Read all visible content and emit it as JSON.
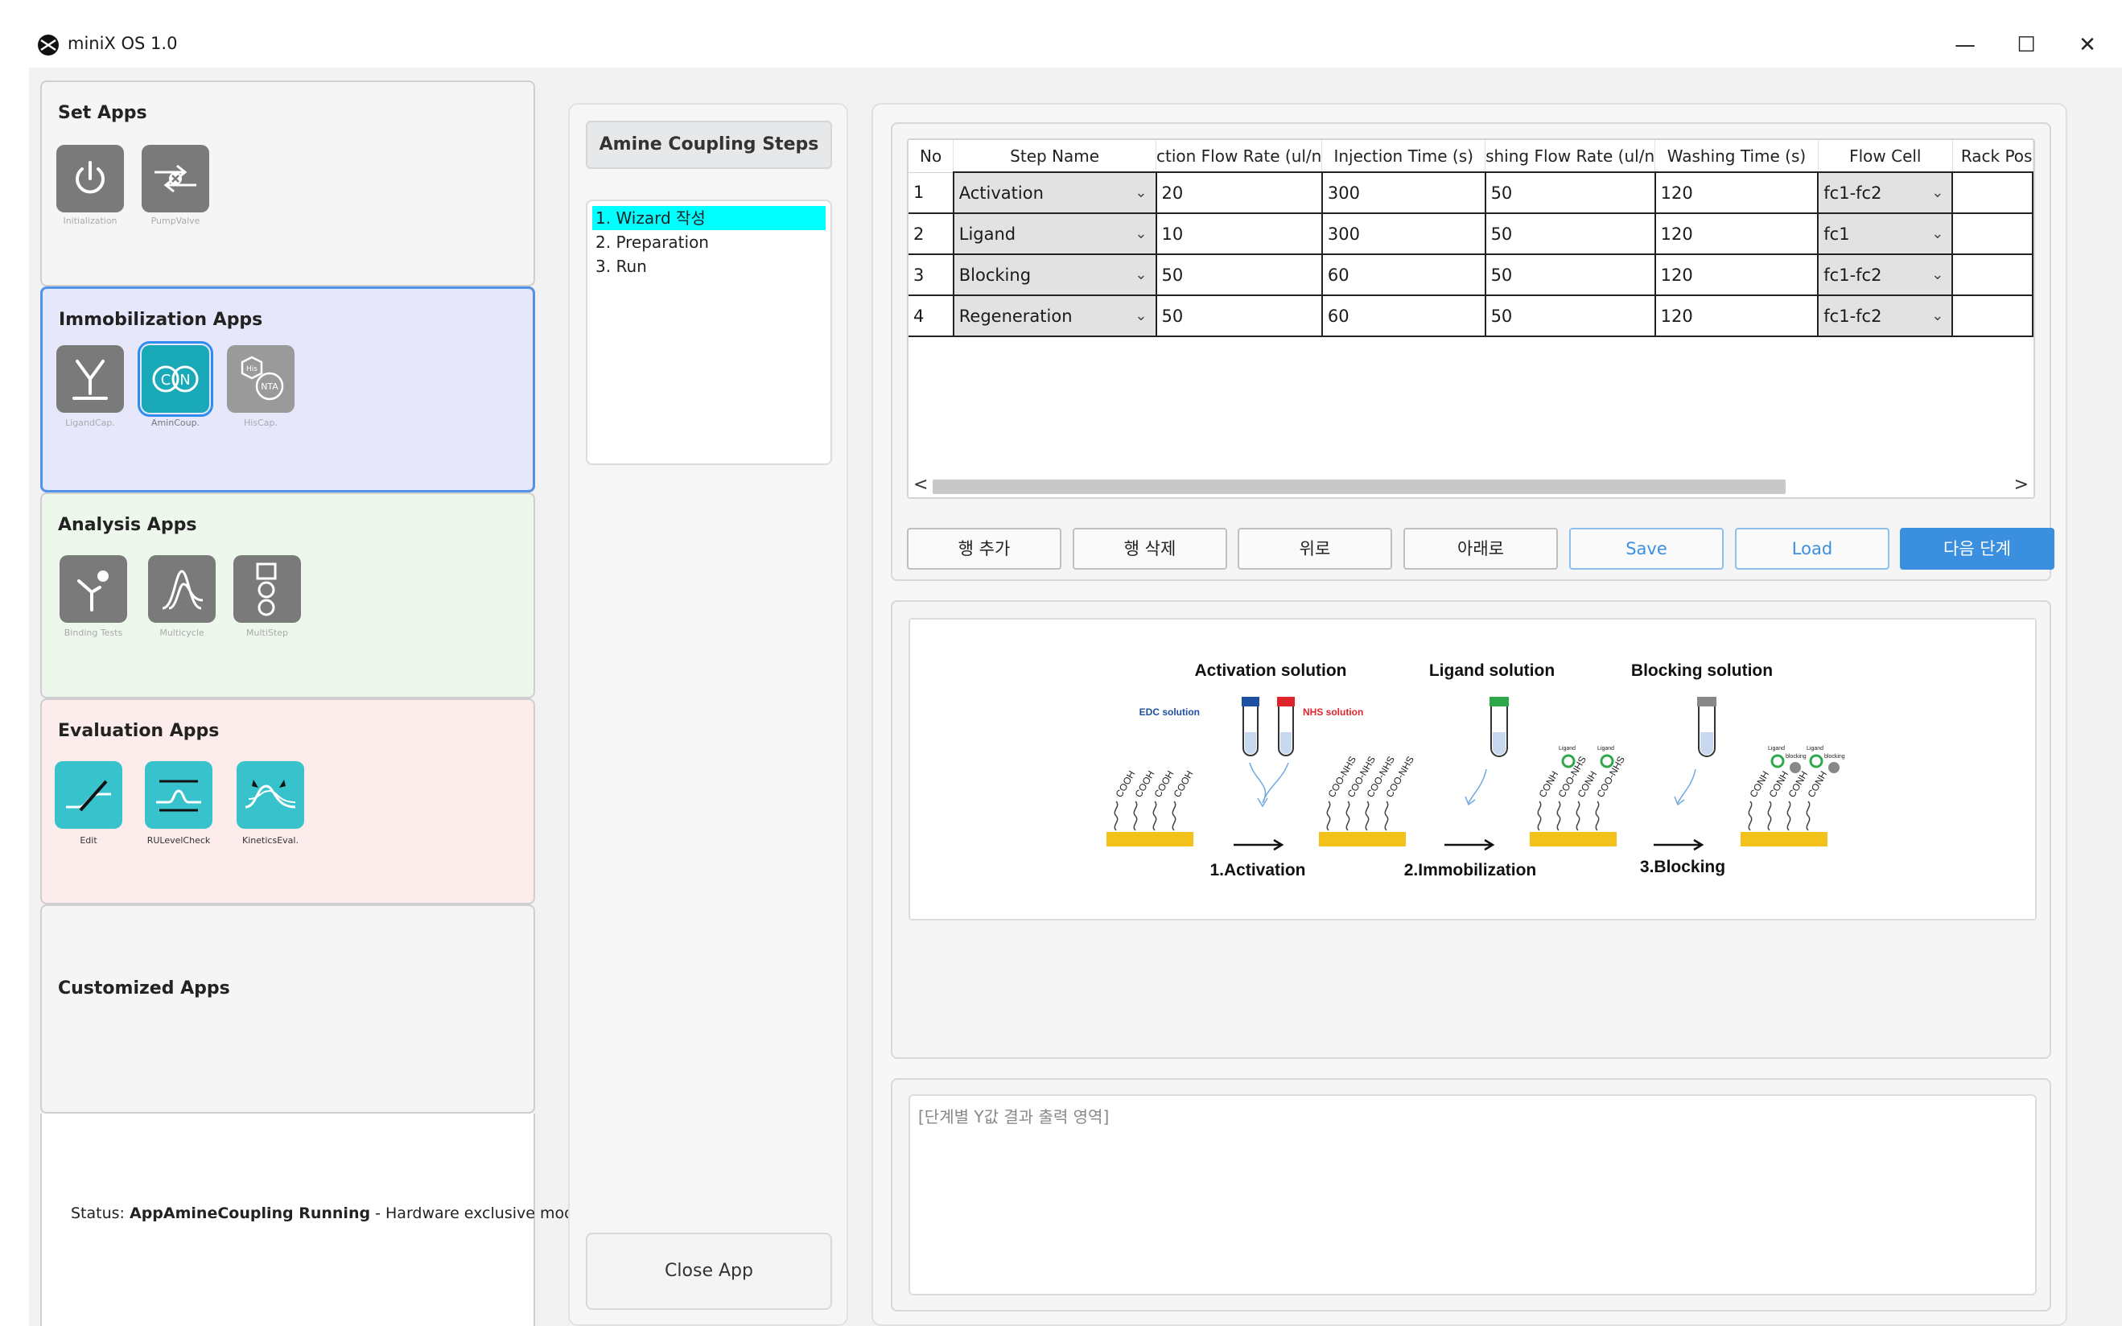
{
  "window": {
    "title": "miniX OS 1.0",
    "minimize": "—",
    "maximize": "☐",
    "close": "✕"
  },
  "groups": {
    "set": {
      "title": "Set Apps",
      "apps": [
        {
          "label": "Initialization"
        },
        {
          "label": "PumpValve"
        }
      ]
    },
    "immobilization": {
      "title": "Immobilization Apps",
      "apps": [
        {
          "label": "LigandCap."
        },
        {
          "label": "AminCoup.",
          "badge": "C N"
        },
        {
          "label": "HisCap.",
          "badge1": "His",
          "badge2": "NTA"
        }
      ]
    },
    "analysis": {
      "title": "Analysis Apps",
      "apps": [
        {
          "label": "Binding Tests"
        },
        {
          "label": "Multicycle"
        },
        {
          "label": "MultiStep"
        }
      ]
    },
    "evaluation": {
      "title": "Evaluation Apps",
      "apps": [
        {
          "label": "Edit"
        },
        {
          "label": "RULevelCheck"
        },
        {
          "label": "KineticsEval."
        }
      ]
    },
    "customized": {
      "title": "Customized Apps"
    }
  },
  "status": {
    "prefix": "Status:",
    "app": "AppAmineCoupling Running",
    "suffix": "- Hardware exclusive mode"
  },
  "steps": {
    "header": "Amine Coupling Steps",
    "items": [
      "1. Wizard 작성",
      "2. Preparation",
      "3. Run"
    ],
    "close_label": "Close App"
  },
  "table": {
    "columns": [
      "No",
      "Step Name",
      "ction Flow Rate (ul/n",
      "Injection Time (s)",
      "shing Flow Rate (ul/n",
      "Washing Time (s)",
      "Flow Cell",
      "Rack Pos"
    ],
    "rows": [
      {
        "no": "1",
        "step": "Activation",
        "flow": "20",
        "inj": "300",
        "wflow": "50",
        "wtime": "120",
        "cell": "fc1-fc2",
        "rack": ""
      },
      {
        "no": "2",
        "step": "Ligand",
        "flow": "10",
        "inj": "300",
        "wflow": "50",
        "wtime": "120",
        "cell": "fc1",
        "rack": ""
      },
      {
        "no": "3",
        "step": "Blocking",
        "flow": "50",
        "inj": "60",
        "wflow": "50",
        "wtime": "120",
        "cell": "fc1-fc2",
        "rack": ""
      },
      {
        "no": "4",
        "step": "Regeneration",
        "flow": "50",
        "inj": "60",
        "wflow": "50",
        "wtime": "120",
        "cell": "fc1-fc2",
        "rack": ""
      }
    ],
    "scroll_left": "<",
    "scroll_right": ">",
    "chevron": "⌄"
  },
  "buttons": {
    "add_row": "행 추가",
    "delete_row": "행 삭제",
    "up": "위로",
    "down": "아래로",
    "save": "Save",
    "load": "Load",
    "next": "다음 단계"
  },
  "diagram": {
    "activation_solution": "Activation solution",
    "ligand_solution": "Ligand solution",
    "blocking_solution": "Blocking solution",
    "edc": "EDC solution",
    "nhs": "NHS solution",
    "step1": "1.Activation",
    "step2": "2.Immobilization",
    "step3": "3.Blocking",
    "cooh": "COOH",
    "coo_nhs": "COO-NHS",
    "conh": "CONH",
    "ligand": "Ligand",
    "blocking": "blocking",
    "colors": {
      "edc_cap": "#1f4fa0",
      "nhs_cap": "#e0242b",
      "ligand_cap": "#2fa84a",
      "blocking_cap": "#888888",
      "surface": "#f2c21b",
      "ligand_molecule": "#2fa84a"
    }
  },
  "output": {
    "placeholder": "[단계별 Y값 결과 출력 영역]"
  }
}
